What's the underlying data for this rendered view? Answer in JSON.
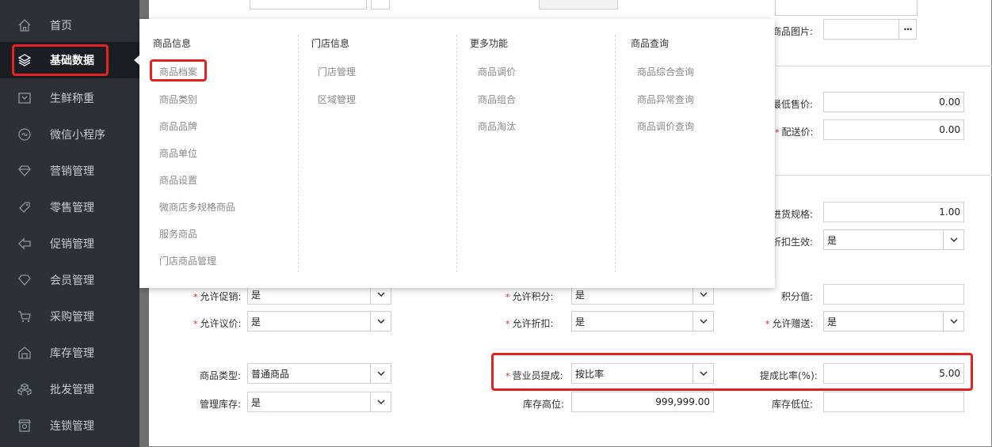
{
  "sidebar": {
    "items": [
      {
        "label": "首页",
        "icon": "home-icon"
      },
      {
        "label": "基础数据",
        "icon": "layers-icon"
      },
      {
        "label": "生鲜称重",
        "icon": "scale-icon"
      },
      {
        "label": "微信小程序",
        "icon": "wechat-miniprogram-icon"
      },
      {
        "label": "营销管理",
        "icon": "diamond-icon"
      },
      {
        "label": "零售管理",
        "icon": "tag-icon"
      },
      {
        "label": "促销管理",
        "icon": "promotion-icon"
      },
      {
        "label": "会员管理",
        "icon": "member-diamond-icon"
      },
      {
        "label": "采购管理",
        "icon": "cart-icon"
      },
      {
        "label": "库存管理",
        "icon": "warehouse-icon"
      },
      {
        "label": "批发管理",
        "icon": "boxes-icon"
      },
      {
        "label": "连锁管理",
        "icon": "chain-store-icon"
      }
    ]
  },
  "mega_menu": {
    "columns": [
      {
        "title": "商品信息",
        "items": [
          "商品档案",
          "商品类别",
          "商品品牌",
          "商品单位",
          "商品设置",
          "微商店多规格商品",
          "服务商品",
          "门店商品管理"
        ]
      },
      {
        "title": "门店信息",
        "items": [
          "门店管理",
          "区域管理"
        ]
      },
      {
        "title": "更多功能",
        "items": [
          "商品调价",
          "商品组合",
          "商品淘汰"
        ]
      },
      {
        "title": "商品查询",
        "items": [
          "商品综合查询",
          "商品异常查询",
          "商品调价查询"
        ]
      }
    ]
  },
  "form": {
    "product_image": {
      "label": "商品图片:",
      "value": "",
      "button": "···"
    },
    "min_price": {
      "label": "最低售价:",
      "value": "0.00"
    },
    "delivery_price": {
      "label": "配送价:",
      "value": "0.00"
    },
    "purchase_spec": {
      "label": "进货规格:",
      "value": "1.00"
    },
    "discount_effective": {
      "label": "折扣生效:",
      "value": "是"
    },
    "allow_promotion": {
      "label": "允许促销:",
      "value": "是"
    },
    "allow_points": {
      "label": "允许积分:",
      "value": "是"
    },
    "points_value": {
      "label": "积分值:",
      "value": ""
    },
    "allow_negotiation": {
      "label": "允许议价:",
      "value": "是"
    },
    "allow_discount": {
      "label": "允许折扣:",
      "value": "是"
    },
    "allow_gift": {
      "label": "允许赠送:",
      "value": "是"
    },
    "product_type": {
      "label": "商品类型:",
      "value": "普通商品"
    },
    "sales_commission": {
      "label": "营业员提成:",
      "value": "按比率"
    },
    "commission_rate": {
      "label": "提成比率(%):",
      "value": "5.00"
    },
    "manage_stock": {
      "label": "管理库存:",
      "value": "是"
    },
    "stock_high": {
      "label": "库存高位:",
      "value": "999,999.00"
    },
    "stock_low": {
      "label": "库存低位:",
      "value": ""
    }
  },
  "colors": {
    "sidebar_bg": "#2d3136",
    "sidebar_active": "#1a1d21",
    "highlight_red": "#e52222",
    "required_star": "#e52222"
  }
}
